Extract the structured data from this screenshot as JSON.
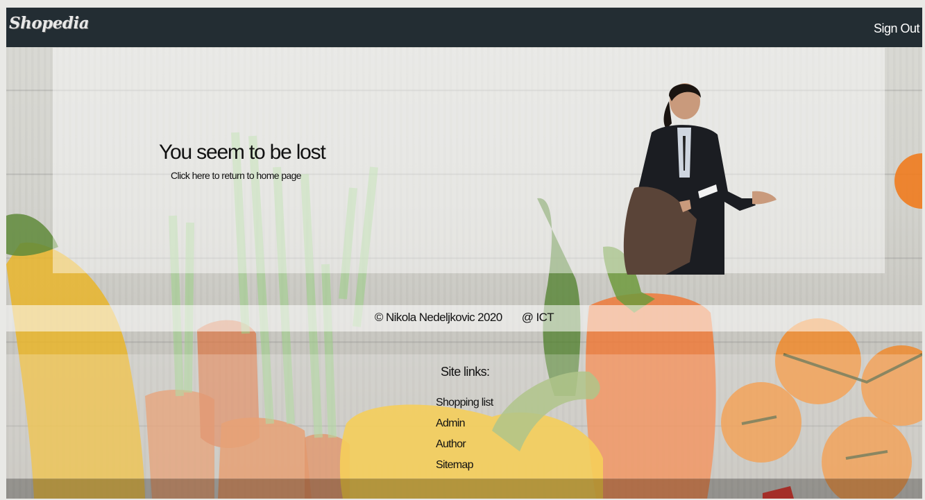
{
  "navbar": {
    "logo_text": "Shopedia",
    "signout_label": "Sign Out"
  },
  "error": {
    "title": "You seem to be lost",
    "link_text": "Click here to return to home page",
    "image_icon": "confused-man-illustration"
  },
  "footer": {
    "copyright": "© Nikola Nedeljkovic 2020",
    "org": "@ ICT",
    "site_links_title": "Site links:",
    "links": [
      "Shopping list",
      "Admin",
      "Author",
      "Sitemap"
    ]
  },
  "colors": {
    "navbar_bg": "#232d33",
    "navbar_text": "#ffffff",
    "text": "#111111"
  }
}
